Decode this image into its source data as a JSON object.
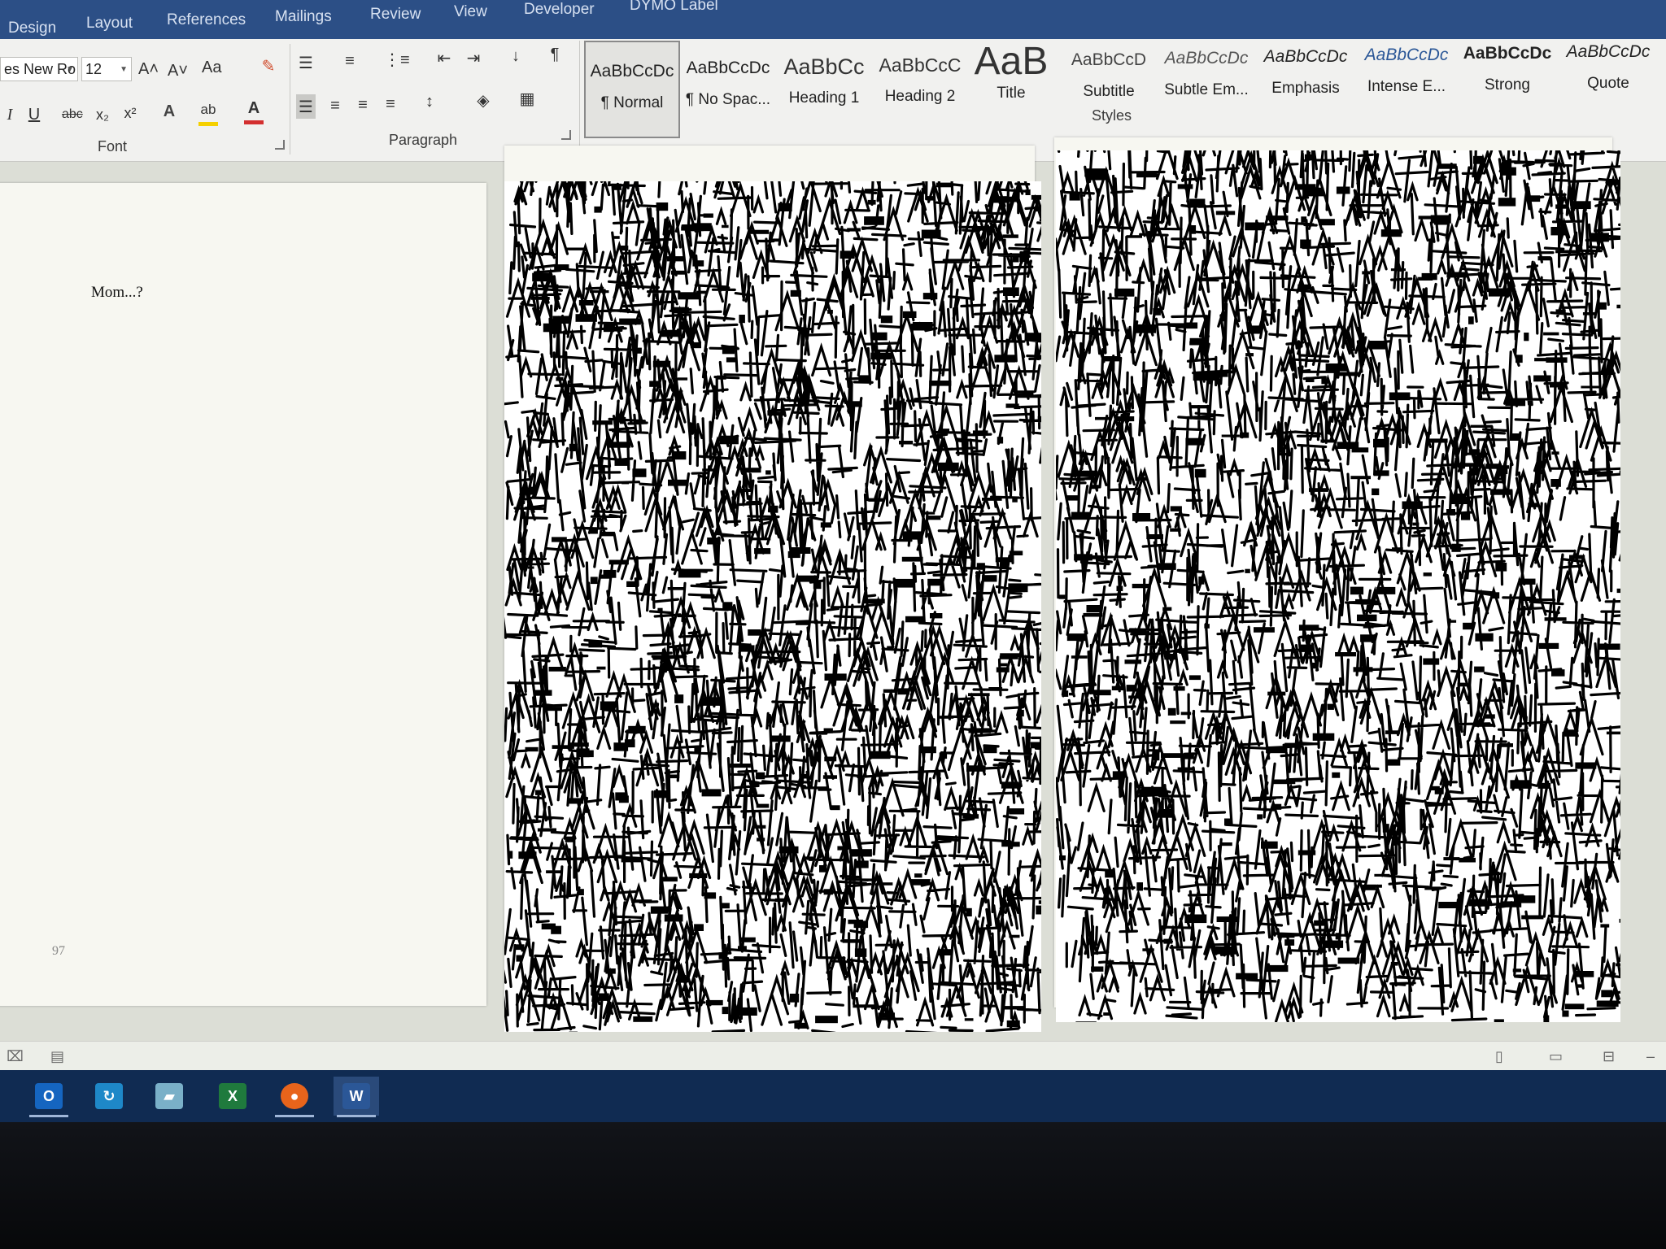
{
  "ribbon_tabs": [
    "Design",
    "Layout",
    "References",
    "Mailings",
    "Review",
    "View",
    "Developer",
    "DYMO Label"
  ],
  "font": {
    "name": "es New Ro",
    "size": "12",
    "grow_icon": "A˄",
    "shrink_icon": "A˅",
    "case_label": "Aa",
    "group_label": "Font",
    "buttons": {
      "italic": "I",
      "underline": "U",
      "strike": "abc",
      "subscript": "x₂",
      "superscript": "x²",
      "text_effects": "A",
      "highlight": "ab",
      "font_color": "A"
    }
  },
  "paragraph": {
    "group_label": "Paragraph",
    "pilcrow": "¶"
  },
  "styles": {
    "group_label": "Styles",
    "items": [
      {
        "preview": "AaBbCcDc",
        "name": "¶ Normal"
      },
      {
        "preview": "AaBbCcDc",
        "name": "¶ No Spac..."
      },
      {
        "preview": "AaBbCc",
        "name": "Heading 1"
      },
      {
        "preview": "AaBbCcC",
        "name": "Heading 2"
      },
      {
        "preview": "AaB",
        "name": "Title"
      },
      {
        "preview": "AaBbCcD",
        "name": "Subtitle"
      },
      {
        "preview": "AaBbCcDc",
        "name": "Subtle Em..."
      },
      {
        "preview": "AaBbCcDc",
        "name": "Emphasis"
      },
      {
        "preview": "AaBbCcDc",
        "name": "Intense E..."
      },
      {
        "preview": "AaBbCcDc",
        "name": "Strong"
      },
      {
        "preview": "AaBbCcDc",
        "name": "Quote"
      }
    ]
  },
  "document": {
    "text": "Mom...?",
    "page_number": "97"
  },
  "taskbar": {
    "apps": [
      {
        "name": "outlook",
        "glyph": "O",
        "color": "#1565c0"
      },
      {
        "name": "sync",
        "glyph": "↻",
        "color": "#1e88c8"
      },
      {
        "name": "notes",
        "glyph": "▰",
        "color": "#7ab0c8"
      },
      {
        "name": "excel",
        "glyph": "X",
        "color": "#1f7a3d"
      },
      {
        "name": "firefox",
        "glyph": "●",
        "color": "#e8641b"
      },
      {
        "name": "word",
        "glyph": "W",
        "color": "#2b5797"
      }
    ]
  },
  "colors": {
    "ribbon_tab_bar": "#2c4f86",
    "taskbar": "#102b52",
    "font_color_accent": "#d32f2f",
    "highlight_accent": "#f5d000"
  }
}
